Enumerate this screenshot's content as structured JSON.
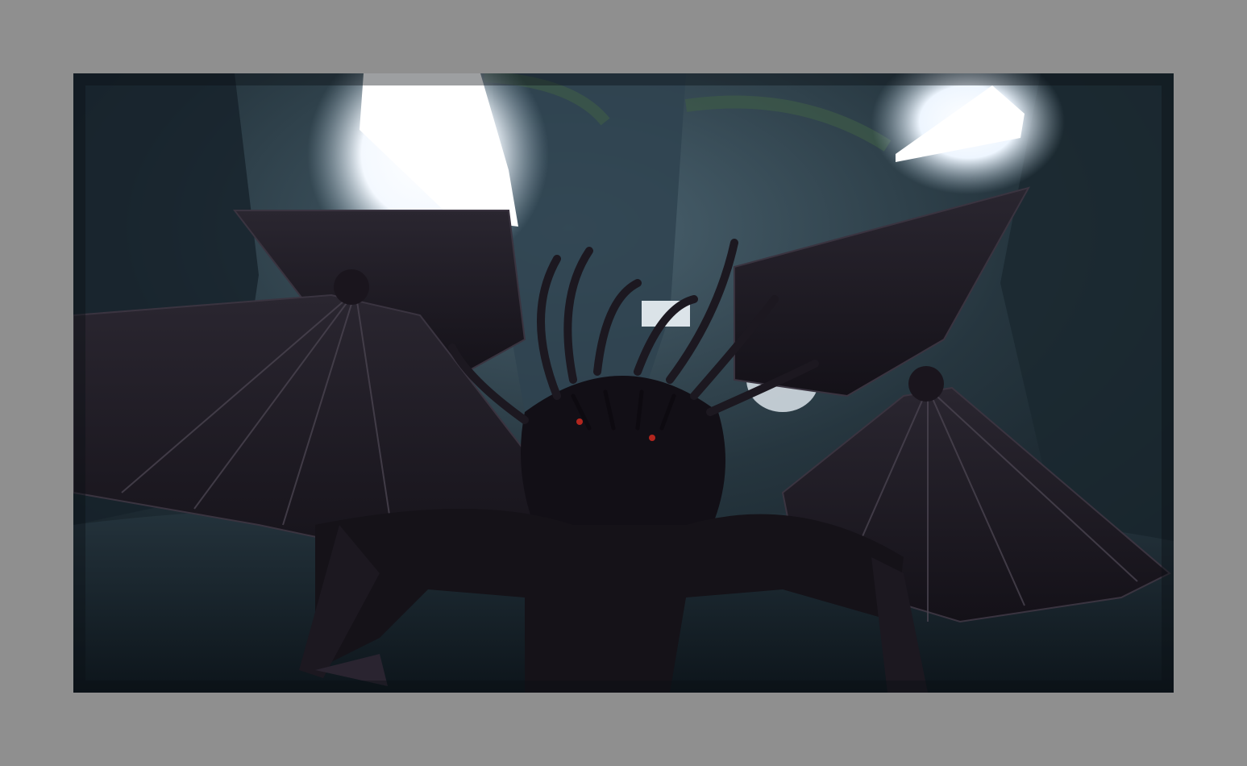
{
  "picture_frame": {
    "border_color": "#8f8f8f"
  },
  "scene": {
    "palette": {
      "sky_light": "#ffffff",
      "cavern_dark": "#0f1820",
      "cavern_mid": "#2c3d48",
      "creature": "#120f16",
      "creature_edge": "#3a3440",
      "arch_green": "#3d5a47",
      "eye_glow": "#b3261e"
    }
  }
}
